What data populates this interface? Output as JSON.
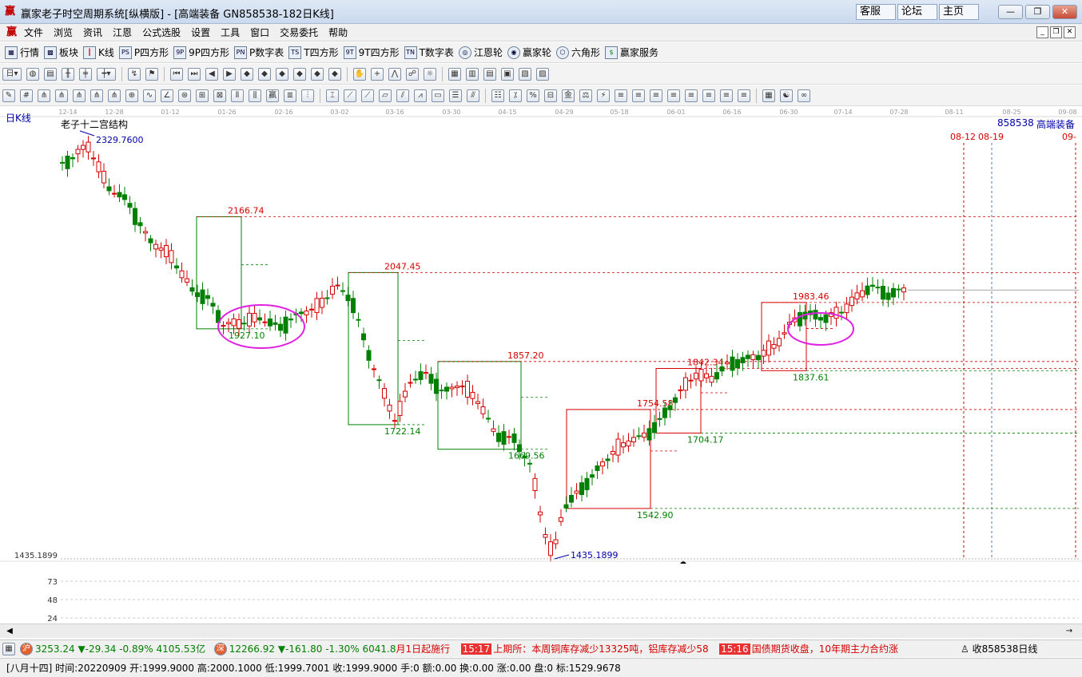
{
  "window": {
    "title": "赢家老子时空周期系统[纵横版] - [高端装备  GN858538-182日K线]",
    "links": [
      "客服",
      "论坛",
      "主页"
    ],
    "controls": [
      "—",
      "❐",
      "✕"
    ]
  },
  "menu": {
    "items": [
      "文件",
      "浏览",
      "资讯",
      "江恩",
      "公式选股",
      "设置",
      "工具",
      "窗口",
      "交易委托",
      "帮助"
    ]
  },
  "toolbar1": {
    "items": [
      {
        "icon": "grid-icon",
        "label": "行情"
      },
      {
        "icon": "blocks-icon",
        "label": "板块"
      },
      {
        "icon": "candle-icon",
        "label": "K线"
      },
      {
        "icon": "ps-icon",
        "label": "P四方形"
      },
      {
        "icon": "9p-icon",
        "label": "9P四方形"
      },
      {
        "icon": "pn-icon",
        "label": "P数字表"
      },
      {
        "icon": "ts-icon",
        "label": "T四方形"
      },
      {
        "icon": "9t-icon",
        "label": "9T四方形"
      },
      {
        "icon": "tn-icon",
        "label": "T数字表"
      },
      {
        "icon": "gann-wheel-icon",
        "label": "江恩轮"
      },
      {
        "icon": "winner-wheel-icon",
        "label": "赢家轮"
      },
      {
        "icon": "hexagon-icon",
        "label": "六角形"
      },
      {
        "icon": "dollar-icon",
        "label": "赢家服务"
      }
    ]
  },
  "chart_header": {
    "period_label": "日K线",
    "indicator_name": "老子十二宫结构",
    "code": "858538",
    "name": "高端装备"
  },
  "chart_data": {
    "type": "candlestick",
    "x_ticks": [
      "12-14",
      "12-28",
      "01-12",
      "01-26",
      "02-16",
      "03-02",
      "03-16",
      "03-30",
      "04-15",
      "04-29",
      "05-18",
      "06-01",
      "06-16",
      "06-30",
      "07-14",
      "07-28",
      "08-11",
      "08-25",
      "09-08"
    ],
    "projected_dates": [
      "08-12",
      "08-19",
      "09-"
    ],
    "y_axis_label": "1435.1899",
    "high_label": "2329.7600",
    "low_label": "1435.1899",
    "box_levels": [
      {
        "high": "2166.74",
        "low": "1927.10",
        "color": "green"
      },
      {
        "high": "2047.45",
        "low": "1722.14",
        "color": "green"
      },
      {
        "high": "1857.20",
        "low": "1669.56",
        "color": "green"
      },
      {
        "high": "1754.58",
        "low": "1542.90",
        "color": "red"
      },
      {
        "high": "1842.34",
        "low": "1704.17",
        "color": "red"
      },
      {
        "high": "1983.46",
        "low": "1837.61",
        "color": "red"
      }
    ],
    "volume_ticks": [
      "73",
      "48",
      "24"
    ]
  },
  "status_ticker": {
    "sh_index": "3253.24",
    "sh_change": "▼-29.34",
    "sh_pct": "-0.89%",
    "sh_amount": "4105.53亿",
    "sz_index": "12266.92",
    "sz_change": "▼-161.80",
    "sz_pct": "-1.30%",
    "sz_amount": "6041.8",
    "news_fragment": "月1日起施行",
    "news_time_1": "15:17",
    "news_1": "上期所：本周铜库存减少13325吨，铝库存减少58",
    "news_time_2": "15:16",
    "news_2": "国债期货收盘，10年期主力合约涨",
    "right_label": "收858538日线"
  },
  "status_info": {
    "text": "[八月十四] 时间:20220909 开:1999.9000 高:2000.1000 低:1999.7001 收:1999.9000 手:0 额:0.00 换:0.00 涨:0.00 盘:0 标:1529.9678"
  },
  "colors": {
    "up": "#d40000",
    "down": "#008000",
    "label_blue": "#0000aa"
  }
}
